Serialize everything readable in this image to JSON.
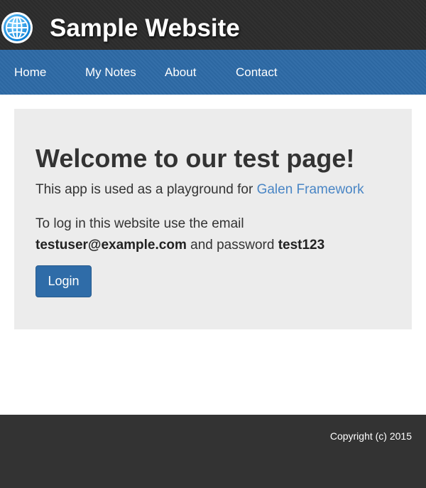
{
  "header": {
    "site_title": "Sample Website",
    "logo_icon": "globe-icon"
  },
  "nav": {
    "items": [
      {
        "label": "Home"
      },
      {
        "label": "My Notes"
      },
      {
        "label": "About"
      },
      {
        "label": "Contact"
      }
    ]
  },
  "main": {
    "heading": "Welcome to our test page!",
    "intro_text": "This app is used as a playground for ",
    "intro_link": "Galen Framework",
    "login_text_1": "To log in this website use the email ",
    "email": "testuser@example.com",
    "login_text_2": " and password ",
    "password": "test123",
    "login_button": "Login"
  },
  "footer": {
    "copyright": "Copyright (c) 2015"
  },
  "colors": {
    "header_bg": "#2c2c2c",
    "nav_bg": "#2d6aa6",
    "panel_bg": "#ececec",
    "link": "#4a86c5",
    "button_bg": "#2f6ca8",
    "footer_bg": "#333333"
  }
}
